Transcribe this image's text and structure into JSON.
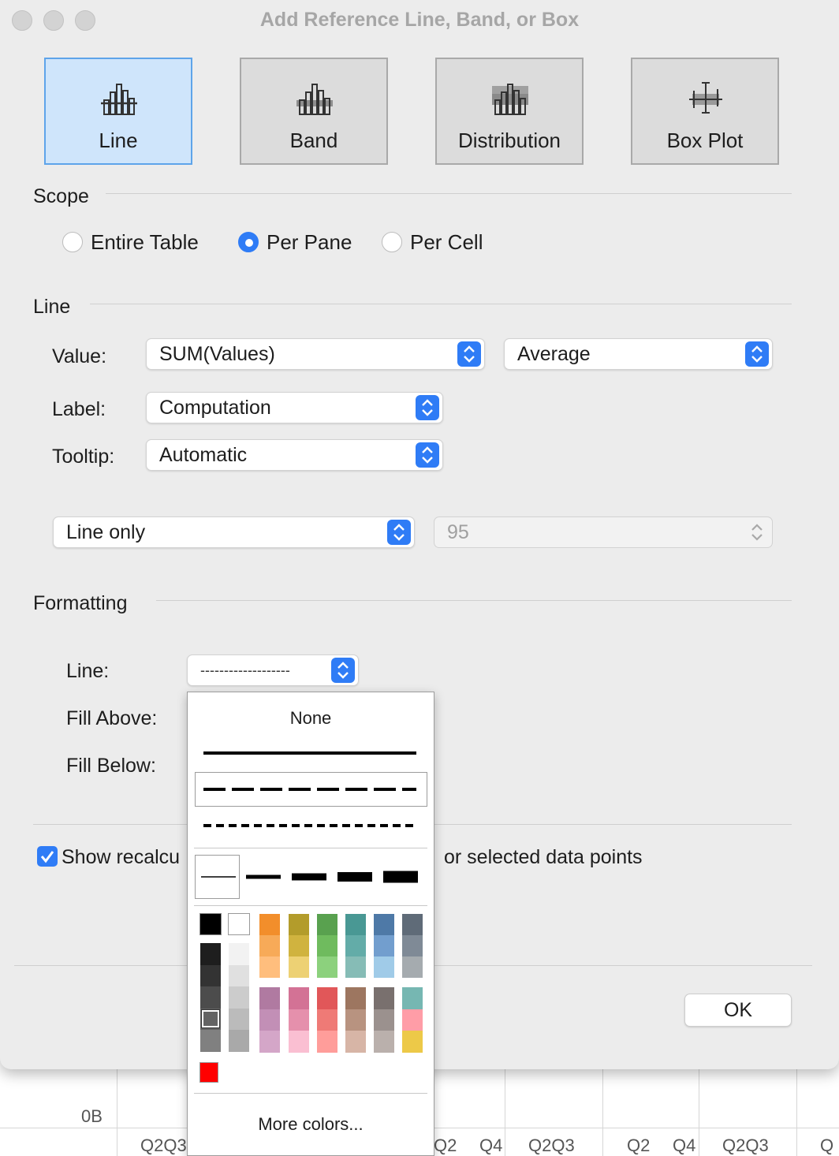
{
  "window": {
    "title": "Add Reference Line, Band, or Box"
  },
  "types": [
    {
      "label": "Line",
      "icon": "line-reference-icon",
      "selected": true
    },
    {
      "label": "Band",
      "icon": "band-reference-icon",
      "selected": false
    },
    {
      "label": "Distribution",
      "icon": "distribution-reference-icon",
      "selected": false
    },
    {
      "label": "Box Plot",
      "icon": "box-plot-reference-icon",
      "selected": false
    }
  ],
  "scope": {
    "header": "Scope",
    "options": [
      {
        "label": "Entire Table",
        "selected": false
      },
      {
        "label": "Per Pane",
        "selected": true
      },
      {
        "label": "Per Cell",
        "selected": false
      }
    ]
  },
  "line": {
    "header": "Line",
    "value_label": "Value:",
    "value_field": "SUM(Values)",
    "value_aggregation": "Average",
    "label_label": "Label:",
    "label_value": "Computation",
    "tooltip_label": "Tooltip:",
    "tooltip_value": "Automatic",
    "confidence_mode": "Line only",
    "confidence_value": "95"
  },
  "formatting": {
    "header": "Formatting",
    "line_label": "Line:",
    "line_value": "-------------------",
    "fill_above_label": "Fill Above:",
    "fill_below_label": "Fill Below:"
  },
  "recalc": {
    "checked": true,
    "text_start": "Show recalcu",
    "text_end": "or selected data points"
  },
  "ok_label": "OK",
  "popup": {
    "none_label": "None",
    "more_colors": "More colors...",
    "line_styles": [
      "solid",
      "dashed",
      "dotted"
    ],
    "selected_style": "dashed",
    "widths": [
      "thin",
      "medium",
      "thick",
      "thicker",
      "thickest"
    ],
    "selected_width": "thin",
    "grey_column_dark": [
      "#000000",
      "#1e1e1e",
      "#333333",
      "#4c4c4c",
      "#636363",
      "#808080"
    ],
    "grey_column_light": [
      "#ffffff",
      "#f2f2f2",
      "#e0e0e0",
      "#cccccc",
      "#bbbbbb",
      "#a9a9a9"
    ],
    "selected_color": "#636363",
    "color_columns_top": [
      [
        "#f28e2b",
        "#f7aa58",
        "#ffbe7d"
      ],
      [
        "#b39c2b",
        "#d0b33f",
        "#edd174"
      ],
      [
        "#59a14f",
        "#6fbb5e",
        "#8cd17d"
      ],
      [
        "#499894",
        "#63aca8",
        "#86bcb6"
      ],
      [
        "#4e79a7",
        "#729ece",
        "#a0cbe8"
      ],
      [
        "#5f6b78",
        "#7f8a96",
        "#a5abaf"
      ]
    ],
    "color_columns_bottom": [
      [
        "#b07aa1",
        "#c28fb6",
        "#d4a6c8"
      ],
      [
        "#d37295",
        "#e590ac",
        "#fabfd2"
      ],
      [
        "#e15759",
        "#ef7a76",
        "#ff9d9a"
      ],
      [
        "#9d7660",
        "#b89380",
        "#d7b5a6"
      ],
      [
        "#79706e",
        "#9b918e",
        "#bab0ac"
      ],
      [
        "#76b7b2",
        "#ff9da7",
        "#edc948"
      ]
    ],
    "recent_color": "#ff0000"
  },
  "background": {
    "axis_zero": "0B",
    "quarter_labels": [
      "Q2Q3",
      "Q2",
      "Q4",
      "Q2Q3",
      "Q2",
      "Q4",
      "Q2Q3",
      "Q"
    ]
  }
}
